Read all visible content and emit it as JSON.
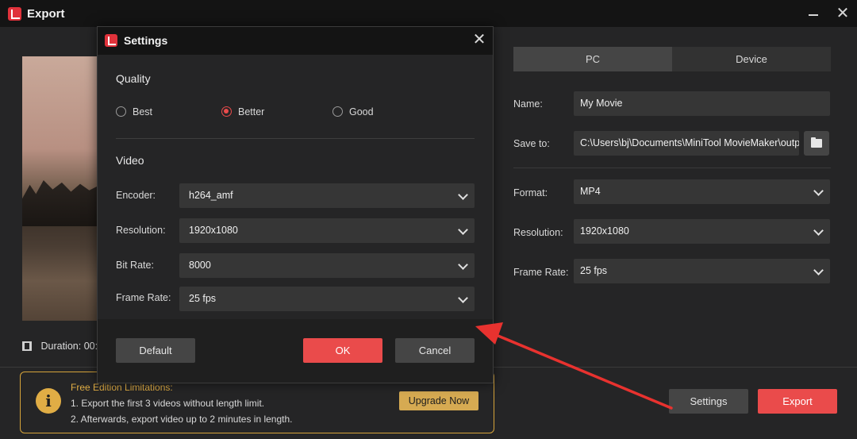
{
  "window": {
    "title": "Export",
    "minimize_icon": "minimize-icon",
    "close_icon": "close-icon"
  },
  "export_panel": {
    "duration_label": "Duration:",
    "duration_value": "00:",
    "tabs": [
      {
        "label": "PC",
        "active": true
      },
      {
        "label": "Device",
        "active": false
      }
    ],
    "name": {
      "label": "Name:",
      "value": "My Movie"
    },
    "save_to": {
      "label": "Save to:",
      "value": "C:\\Users\\bj\\Documents\\MiniTool MovieMaker\\outp"
    },
    "format": {
      "label": "Format:",
      "value": "MP4"
    },
    "resolution": {
      "label": "Resolution:",
      "value": "1920x1080"
    },
    "frame_rate": {
      "label": "Frame Rate:",
      "value": "25 fps"
    }
  },
  "limitations": {
    "title": "Free Edition Limitations:",
    "line1": "1. Export the first 3 videos without length limit.",
    "line2": "2. Afterwards, export video up to 2 minutes in length.",
    "upgrade_label": "Upgrade Now"
  },
  "actions": {
    "settings_label": "Settings",
    "export_label": "Export"
  },
  "settings_dialog": {
    "title": "Settings",
    "quality": {
      "title": "Quality",
      "options": [
        {
          "label": "Best",
          "checked": false
        },
        {
          "label": "Better",
          "checked": true
        },
        {
          "label": "Good",
          "checked": false
        }
      ]
    },
    "video": {
      "title": "Video",
      "encoder": {
        "label": "Encoder:",
        "value": "h264_amf"
      },
      "resolution": {
        "label": "Resolution:",
        "value": "1920x1080"
      },
      "bit_rate": {
        "label": "Bit Rate:",
        "value": "8000"
      },
      "frame_rate": {
        "label": "Frame Rate:",
        "value": "25 fps"
      }
    },
    "buttons": {
      "default_label": "Default",
      "ok_label": "OK",
      "cancel_label": "Cancel"
    }
  },
  "colors": {
    "accent": "#ea4b4b",
    "warning": "#e0ad45",
    "annotation_arrow": "#e8322f"
  }
}
